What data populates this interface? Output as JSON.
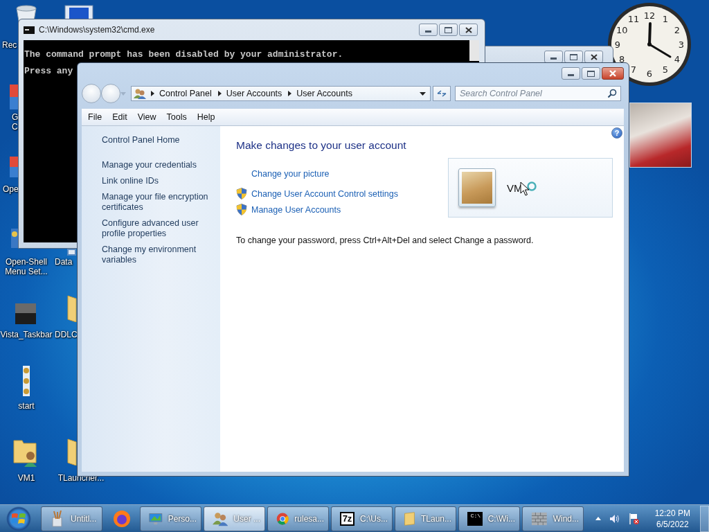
{
  "desktop_icons": [
    {
      "kind": "bin",
      "lines": [
        "Rec"
      ]
    },
    {
      "kind": "app",
      "lines": [
        "G",
        "C"
      ]
    },
    {
      "kind": "app",
      "lines": [
        "Ope"
      ]
    },
    {
      "kind": "shell",
      "lines": [
        "Open-Shell",
        "Menu Set..."
      ]
    },
    {
      "kind": "partial",
      "lines": [
        "Data"
      ]
    },
    {
      "kind": "tile",
      "lines": [
        "Vista_Taskbar"
      ]
    },
    {
      "kind": "folder",
      "lines": [
        "DDLC"
      ]
    },
    {
      "kind": "dots",
      "lines": [
        "start"
      ]
    },
    {
      "kind": "userfolder",
      "lines": [
        "VM1"
      ]
    },
    {
      "kind": "folder",
      "lines": [
        "TLauncher..."
      ]
    }
  ],
  "cmd_window": {
    "title": "C:\\Windows\\system32\\cmd.exe",
    "lines": [
      "The command prompt has been disabled by your administrator.",
      "Press any"
    ]
  },
  "clock_gadget": {
    "numerals": [
      "12",
      "1",
      "2",
      "3",
      "4",
      "5",
      "6",
      "7",
      "8",
      "9",
      "10",
      "11"
    ]
  },
  "control_panel": {
    "breadcrumb": [
      "Control Panel",
      "User Accounts",
      "User Accounts"
    ],
    "search": {
      "placeholder": "Search Control Panel"
    },
    "menu": [
      "File",
      "Edit",
      "View",
      "Tools",
      "Help"
    ],
    "sidebar": {
      "home": "Control Panel Home",
      "items": [
        "Manage your credentials",
        "Link online IDs",
        "Manage your file encryption certificates",
        "Configure advanced user profile properties",
        "Change my environment variables"
      ]
    },
    "heading": "Make changes to your user account",
    "help": "?",
    "tasks": [
      {
        "label": "Change your picture",
        "shield": false
      },
      {
        "label": "Change User Account Control settings",
        "shield": true
      },
      {
        "label": "Manage User Accounts",
        "shield": true
      }
    ],
    "account": {
      "name": "VM"
    },
    "note": "To change your password, press Ctrl+Alt+Del and select Change a password."
  },
  "taskbar": {
    "buttons": [
      {
        "kind": "paint",
        "label": "Untitl...",
        "selected": false
      },
      {
        "kind": "firefox",
        "selected": false
      },
      {
        "kind": "personalize",
        "label": "Perso...",
        "selected": false
      },
      {
        "kind": "users",
        "label": "User ...",
        "selected": true
      },
      {
        "kind": "chrome",
        "label": "rulesa...",
        "selected": false
      },
      {
        "kind": "sevenzip",
        "glyph": "7z",
        "label": "C:\\Us...",
        "selected": false
      },
      {
        "kind": "folder",
        "label": "TLaun...",
        "selected": false
      },
      {
        "kind": "cmd",
        "glyph": "C:\\",
        "label": "C:\\Wi...",
        "selected": false
      },
      {
        "kind": "firewall",
        "label": "Wind...",
        "selected": false
      }
    ],
    "clock": {
      "time": "12:20 PM",
      "date": "6/5/2022"
    }
  }
}
